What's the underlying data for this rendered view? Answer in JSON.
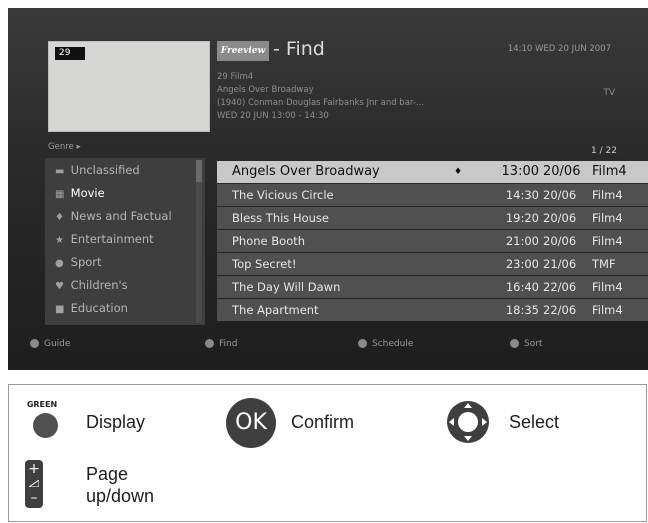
{
  "tv_screen": {
    "channel_badge": "29",
    "logo_text": "Freeview",
    "title": "- Find",
    "datetime": "14:10 WED 20 JUN 2007",
    "info_lines": [
      "29 Film4",
      "Angels Over Broadway",
      "(1940) Conman Douglas Fairbanks Jnr and bar-...",
      "WED 20 JUN 13:00 - 14:30"
    ],
    "programme_type": "TV",
    "genre_label": "Genre ▸",
    "page_count": "1 / 22",
    "genres": [
      {
        "label": "Unclassified",
        "icon": "folder-icon",
        "glyph": "▬"
      },
      {
        "label": "Movie",
        "icon": "film-icon",
        "glyph": "▦"
      },
      {
        "label": "News and Factual",
        "icon": "microphone-icon",
        "glyph": "♦"
      },
      {
        "label": "Entertainment",
        "icon": "star-icon",
        "glyph": "★"
      },
      {
        "label": "Sport",
        "icon": "ball-icon",
        "glyph": "●"
      },
      {
        "label": "Children's",
        "icon": "teddy-icon",
        "glyph": "♥"
      },
      {
        "label": "Education",
        "icon": "book-icon",
        "glyph": "■"
      }
    ],
    "selected_genre": "Movie",
    "programmes": [
      {
        "title": "Angels Over Broadway",
        "marker": "♦",
        "time": "13:00",
        "date": "20/06",
        "channel": "Film4"
      },
      {
        "title": "The Vicious Circle",
        "marker": "",
        "time": "14:30",
        "date": "20/06",
        "channel": "Film4"
      },
      {
        "title": "Bless This House",
        "marker": "",
        "time": "19:20",
        "date": "20/06",
        "channel": "Film4"
      },
      {
        "title": "Phone Booth",
        "marker": "",
        "time": "21:00",
        "date": "20/06",
        "channel": "Film4"
      },
      {
        "title": "Top Secret!",
        "marker": "",
        "time": "23:00",
        "date": "21/06",
        "channel": "TMF"
      },
      {
        "title": "The Day Will Dawn",
        "marker": "",
        "time": "16:40",
        "date": "22/06",
        "channel": "Film4"
      },
      {
        "title": "The Apartment",
        "marker": "",
        "time": "18:35",
        "date": "22/06",
        "channel": "Film4"
      }
    ],
    "footer": {
      "guide": "Guide",
      "find": "Find",
      "schedule": "Schedule",
      "sort": "Sort"
    }
  },
  "legend": {
    "green_key_label": "GREEN",
    "display": "Display",
    "ok_key_label": "OK",
    "confirm": "Confirm",
    "select": "Select",
    "page_key_plus": "+",
    "page_key_minus": "–",
    "page_line1": "Page",
    "page_line2": "up/down"
  },
  "colors": {
    "selected_row": "#c8c8c8",
    "row": "#505050",
    "screen_bg": "#2b2b2b"
  }
}
